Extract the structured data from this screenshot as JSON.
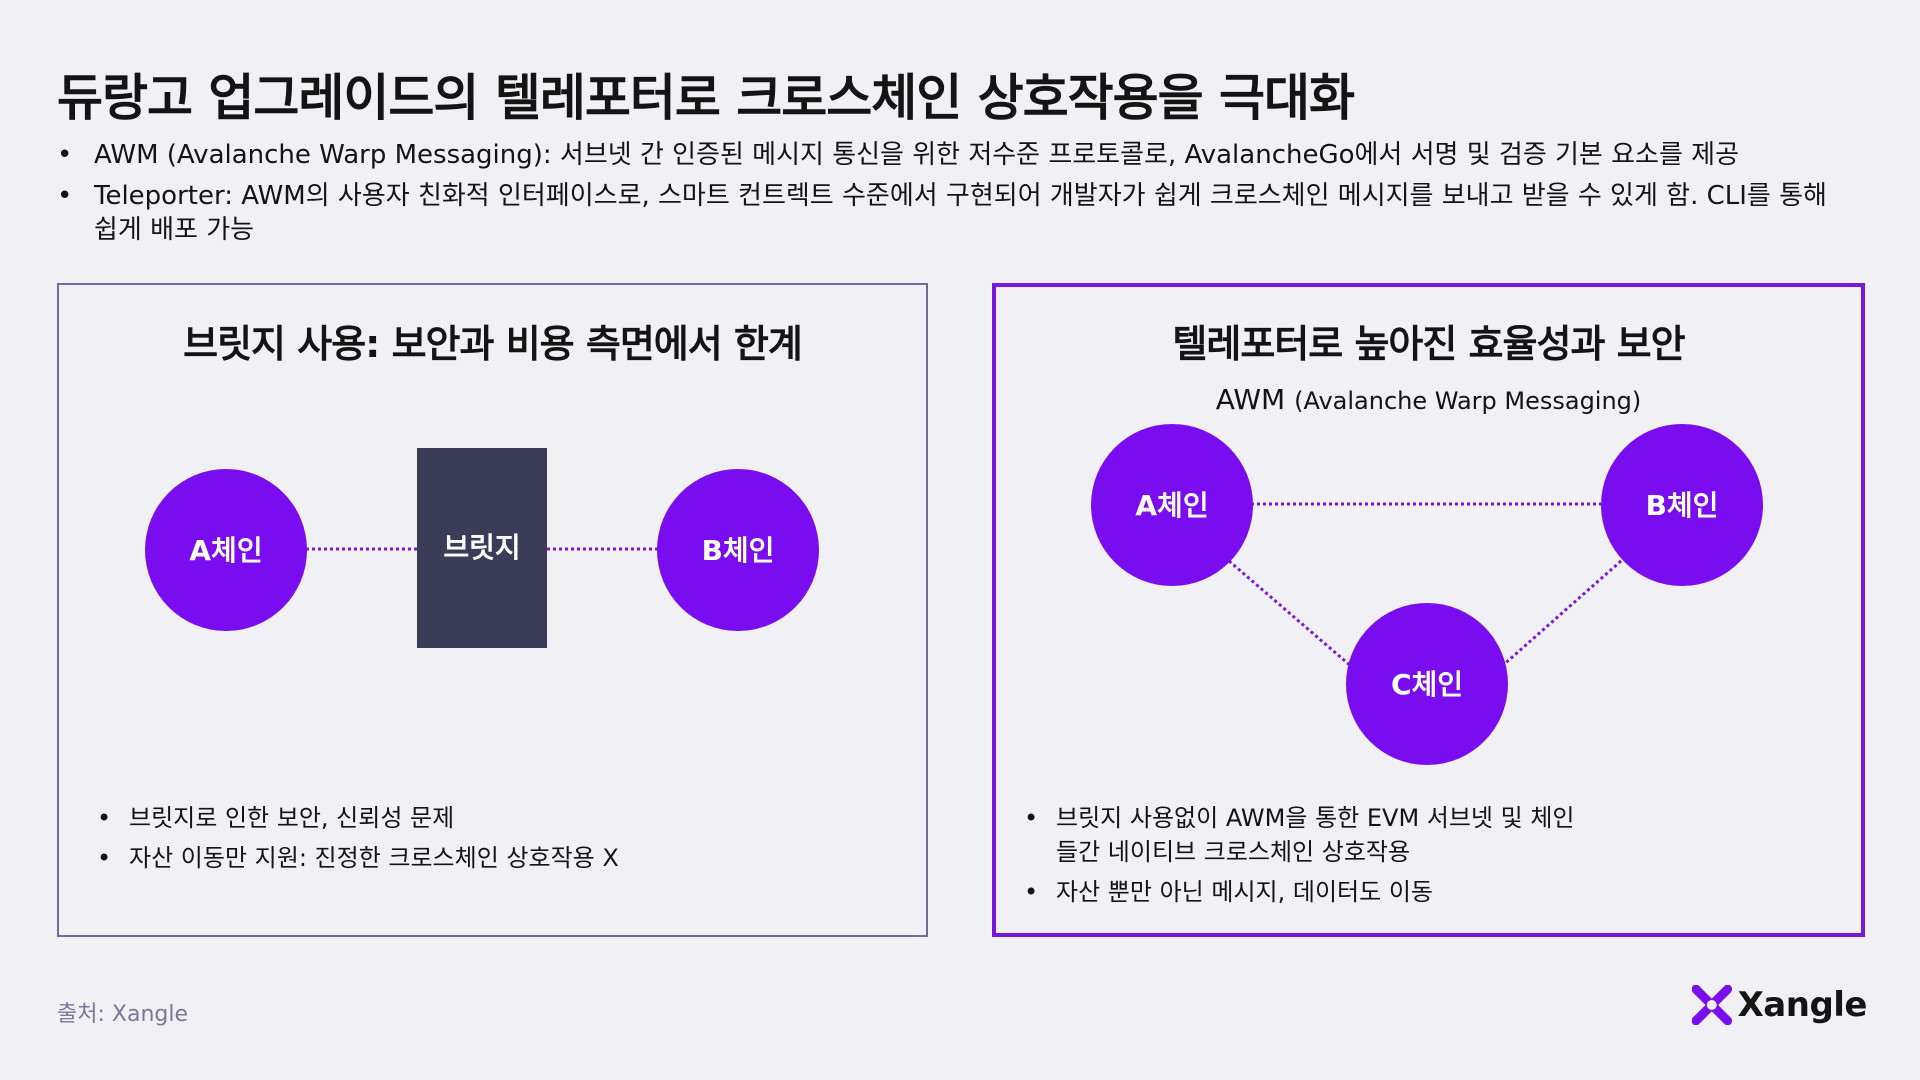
{
  "title": "듀랑고 업그레이드의 텔레포터로 크로스체인 상호작용을 극대화",
  "bullets": [
    "AWM (Avalanche Warp Messaging): 서브넷 간 인증된 메시지 통신을 위한 저수준 프로토콜로, AvalancheGo에서 서명 및 검증 기본 요소를 제공",
    "Teleporter: AWM의 사용자 친화적 인터페이스로, 스마트 컨트렉트 수준에서 구현되어 개발자가 쉽게 크로스체인 메시지를 보내고 받을 수 있게 함. CLI를 통해 쉽게 배포 가능"
  ],
  "left_panel": {
    "title": "브릿지 사용: 보안과 비용 측면에서 한계",
    "nodes": {
      "a": "A체인",
      "bridge": "브릿지",
      "b": "B체인"
    },
    "bullets": [
      "브릿지로 인한 보안, 신뢰성 문제",
      "자산 이동만 지원: 진정한 크로스체인 상호작용 X"
    ]
  },
  "right_panel": {
    "title": "텔레포터로 높아진 효율성과 보안",
    "subtitle_main": "AWM",
    "subtitle_paren": "(Avalanche Warp Messaging)",
    "nodes": {
      "a": "A체인",
      "b": "B체인",
      "c": "C체인"
    },
    "bullets": [
      "브릿지 사용없이 AWM을 통한 EVM 서브넷 및 체인들간 네이티브 크로스체인 상호작용",
      "자산 뿐만 아닌 메시지, 데이터도 이동"
    ]
  },
  "source": "출처: Xangle",
  "logo": {
    "text": "Xangle",
    "icon": "xangle-x-icon"
  },
  "colors": {
    "background": "#f1f0f5",
    "chain_node": "#7a0cf0",
    "bridge_box": "#3b3c58",
    "left_border": "#6e6b9e",
    "right_border": "#7a16e0",
    "dotted_line": "#7a16e0"
  }
}
